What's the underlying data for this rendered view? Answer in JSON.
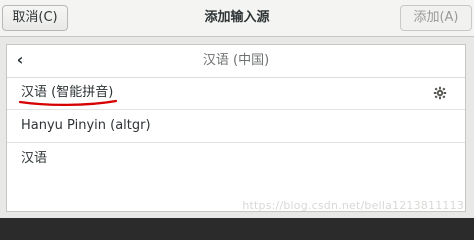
{
  "dialog": {
    "title": "添加输入源",
    "cancel_label": "取消(C)",
    "add_label": "添加(A)"
  },
  "panel": {
    "back_icon": "chevron-left-icon",
    "title": "汉语 (中国)",
    "rows": [
      {
        "label": "汉语 (智能拼音)",
        "has_settings": true
      },
      {
        "label": "Hanyu Pinyin (altgr)",
        "has_settings": false
      },
      {
        "label": "汉语",
        "has_settings": false
      }
    ]
  },
  "watermark": "https://blog.csdn.net/bella1213811113",
  "colors": {
    "annotation_underline": "#d60000"
  }
}
